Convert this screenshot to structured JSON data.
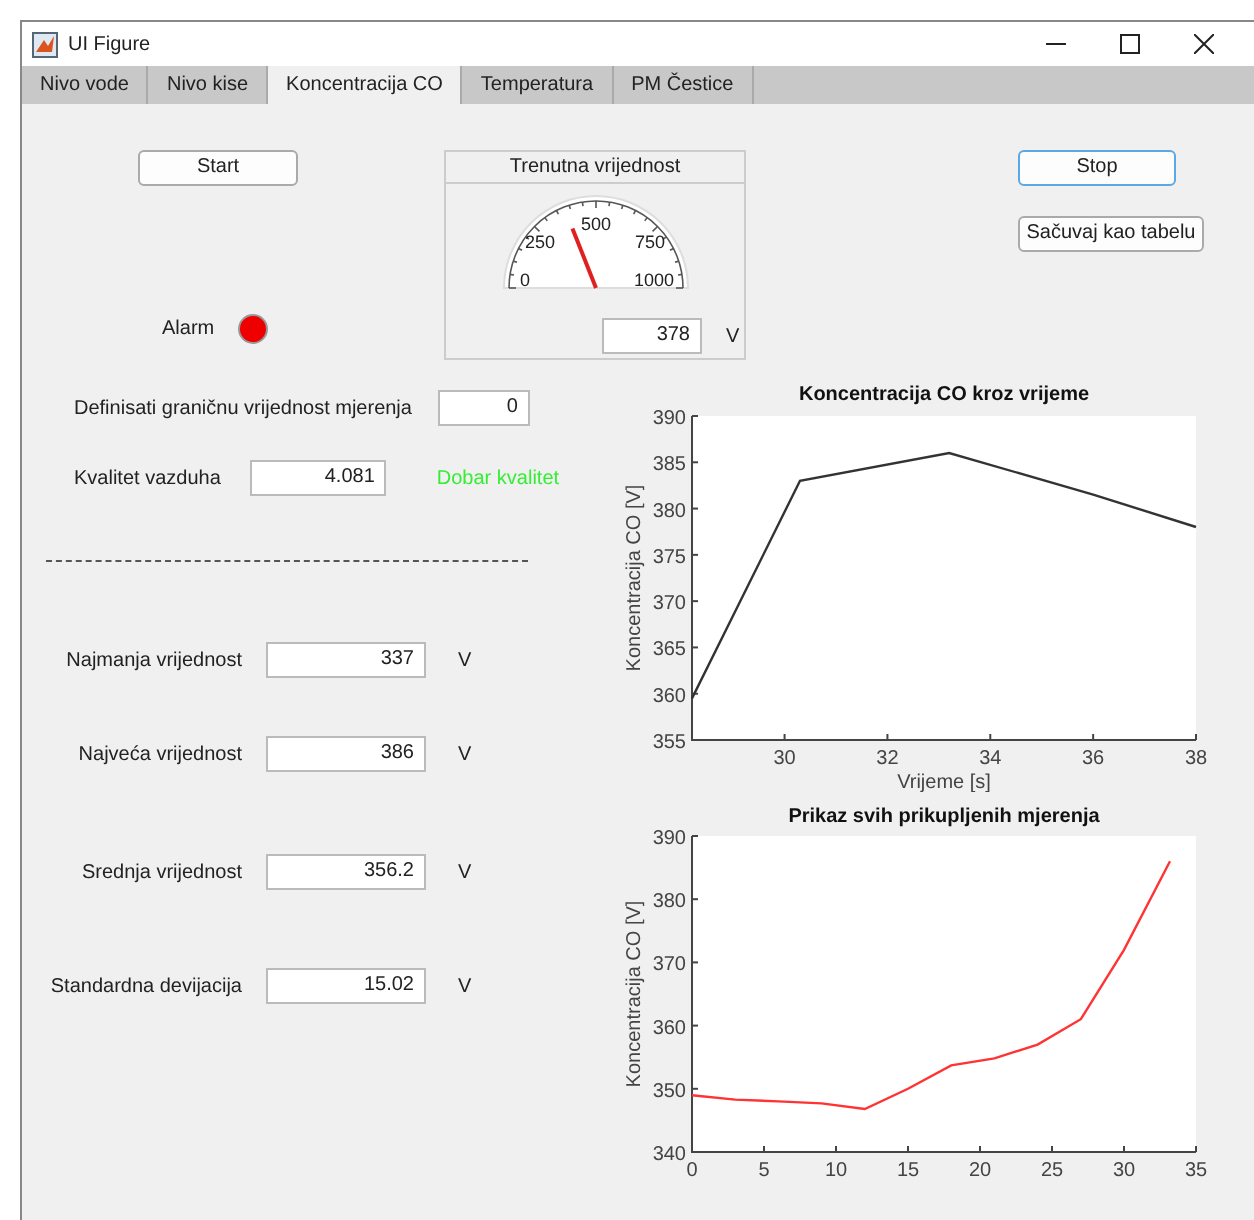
{
  "window": {
    "title": "UI Figure"
  },
  "tabs": [
    {
      "label": "Nivo vode",
      "selected": false
    },
    {
      "label": "Nivo kise",
      "selected": false
    },
    {
      "label": "Koncentracija CO",
      "selected": true
    },
    {
      "label": "Temperatura",
      "selected": false
    },
    {
      "label": "PM Čestice",
      "selected": false
    }
  ],
  "start_button": "Start",
  "stop_button": "Stop",
  "save_button": "Sačuvaj kao tabelu",
  "alarm": {
    "label": "Alarm",
    "on": true
  },
  "gauge_panel": {
    "title": "Trenutna vrijednost",
    "scale": [
      "0",
      "250",
      "500",
      "750",
      "1000"
    ],
    "value": "378",
    "unit": "V"
  },
  "threshold": {
    "label": "Definisati graničnu vrijednost mjerenja",
    "value": "0"
  },
  "air_quality": {
    "label": "Kvalitet vazduha",
    "value": "4.081",
    "status": "Dobar kvalitet"
  },
  "stats": [
    {
      "label": "Najmanja vrijednost",
      "value": "337",
      "unit": "V"
    },
    {
      "label": "Najveća vrijednost",
      "value": "386",
      "unit": "V"
    },
    {
      "label": "Srednja vrijednost",
      "value": "356.2",
      "unit": "V"
    },
    {
      "label": "Standardna devijacija",
      "value": "15.02",
      "unit": "V"
    }
  ],
  "charts": [
    {
      "chart_data": {
        "type": "line",
        "title": "Koncentracija CO kroz vrijeme",
        "xlabel": "Vrijeme [s]",
        "ylabel": "Koncentracija CO [V]",
        "xlim": [
          28.2,
          38
        ],
        "ylim": [
          355,
          390
        ],
        "xticks": [
          30,
          32,
          34,
          36,
          38
        ],
        "yticks": [
          355,
          360,
          365,
          370,
          375,
          380,
          385,
          390
        ],
        "series": [
          {
            "color": "#333333",
            "x": [
              28.2,
              30.3,
              33.2,
              36,
              38
            ],
            "values": [
              359.5,
              383,
              386,
              381.5,
              378
            ]
          }
        ]
      }
    },
    {
      "chart_data": {
        "type": "line",
        "title": "Prikaz svih prikupljenih mjerenja",
        "ylabel": "Koncentracija CO [V]",
        "xlim": [
          0,
          35
        ],
        "ylim": [
          340,
          390
        ],
        "xticks": [
          0,
          5,
          10,
          15,
          20,
          25,
          30,
          35
        ],
        "yticks": [
          340,
          350,
          360,
          370,
          380,
          390
        ],
        "series": [
          {
            "color": "#ff3333",
            "x": [
              0,
              3,
              6,
              9,
              12,
              15,
              18,
              21,
              24,
              27,
              30,
              33.2
            ],
            "values": [
              349,
              348.3,
              348,
              347.7,
              346.8,
              350,
              353.7,
              354.8,
              357,
              361,
              372,
              386
            ]
          }
        ]
      }
    }
  ]
}
